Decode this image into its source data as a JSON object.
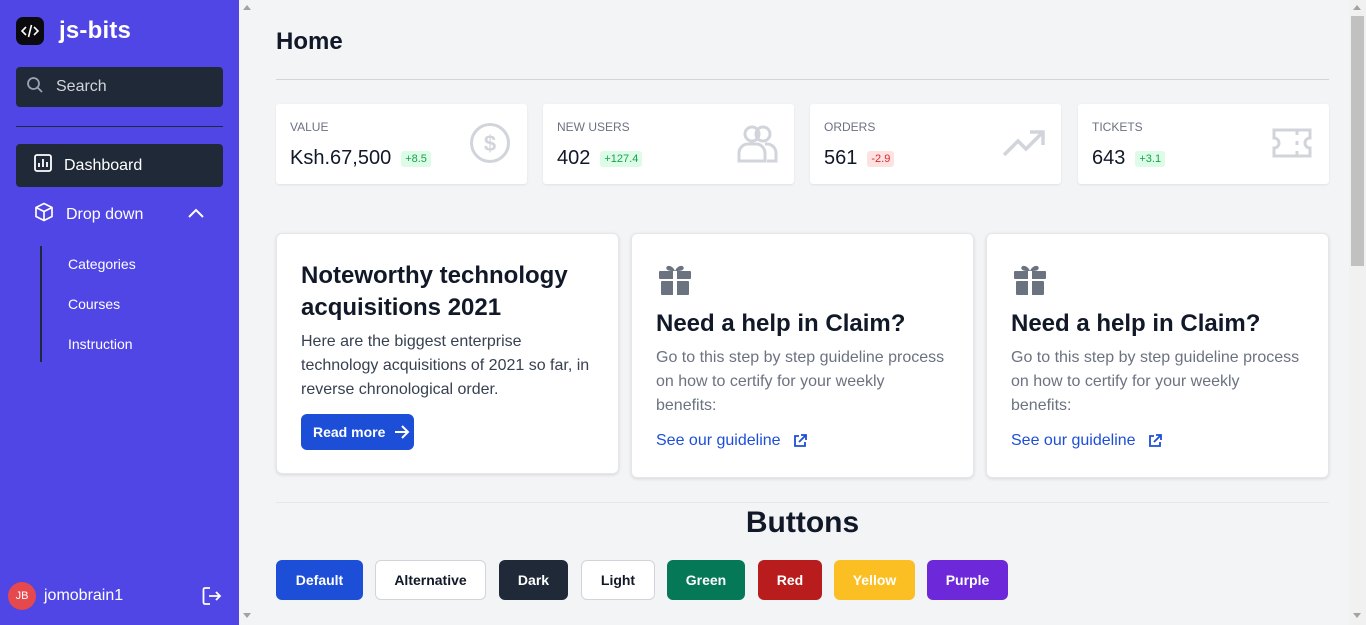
{
  "app": {
    "title": "js-bits"
  },
  "search": {
    "placeholder": "Search"
  },
  "nav": {
    "dashboard": "Dashboard",
    "dropdown": "Drop down",
    "subitems": [
      "Categories",
      "Courses",
      "Instruction"
    ]
  },
  "user": {
    "initials": "JB",
    "name": "jomobrain1"
  },
  "page": {
    "title": "Home"
  },
  "stats": [
    {
      "label": "Value",
      "value": "Ksh.67,500",
      "change": "+8.5",
      "trend": "up",
      "icon": "dollar-circle-icon"
    },
    {
      "label": "New users",
      "value": "402",
      "change": "+127.4",
      "trend": "up",
      "icon": "users-icon"
    },
    {
      "label": "Orders",
      "value": "561",
      "change": "-2.9",
      "trend": "down",
      "icon": "trending-up-icon"
    },
    {
      "label": "Tickets",
      "value": "643",
      "change": "+3.1",
      "trend": "up",
      "icon": "ticket-icon"
    }
  ],
  "cards": {
    "article": {
      "title_line1": "Noteworthy technology",
      "title_line2": "acquisitions 2021",
      "text_line1": "Here are the biggest enterprise",
      "text_line2": "technology acquisitions of 2021 so far, in",
      "text_line3": "reverse chronological order.",
      "button": "Read more"
    },
    "claim": [
      {
        "title": "Need a help in Claim?",
        "text_line1": "Go to this step by step guideline process",
        "text_line2": "on how to certify for your weekly",
        "text_line3": "benefits:",
        "link": "See our guideline"
      },
      {
        "title": "Need a help in Claim?",
        "text_line1": "Go to this step by step guideline process",
        "text_line2": "on how to certify for your weekly",
        "text_line3": "benefits:",
        "link": "See our guideline"
      }
    ]
  },
  "buttons_section": {
    "title": "Buttons",
    "buttons": [
      {
        "label": "Default",
        "bg": "#1d4ed8",
        "color": "#ffffff"
      },
      {
        "label": "Alternative",
        "bg": "#ffffff",
        "color": "#111827"
      },
      {
        "label": "Dark",
        "bg": "#1f2937",
        "color": "#ffffff"
      },
      {
        "label": "Light",
        "bg": "#ffffff",
        "color": "#111827"
      },
      {
        "label": "Green",
        "bg": "#047857",
        "color": "#ffffff"
      },
      {
        "label": "Red",
        "bg": "#b91c1c",
        "color": "#ffffff"
      },
      {
        "label": "Yellow",
        "bg": "#fbbf24",
        "color": "#ffffff"
      },
      {
        "label": "Purple",
        "bg": "#6d28d9",
        "color": "#ffffff"
      }
    ]
  },
  "colors": {
    "sidebar": "#5046e5",
    "sidebar_dark": "#1f2937",
    "link": "#1d4ed8"
  }
}
